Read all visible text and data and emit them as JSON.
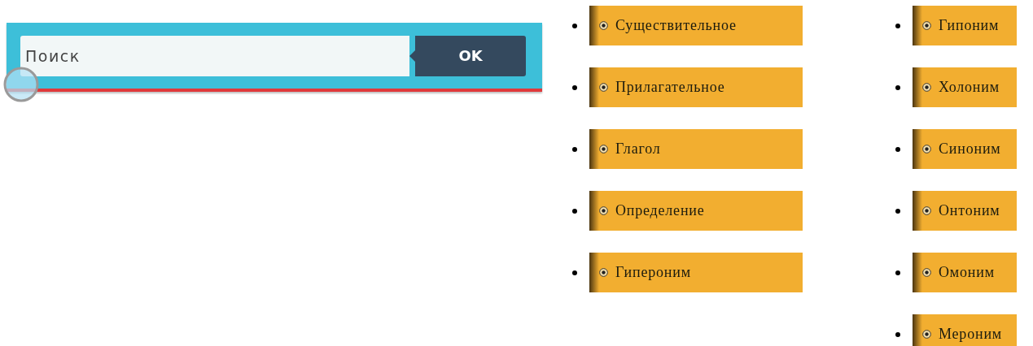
{
  "search": {
    "placeholder": "Поиск",
    "button": "OK"
  },
  "columns": [
    {
      "items": [
        "Существительное",
        "Прилагательное",
        "Глагол",
        "Определение",
        "Гипероним"
      ]
    },
    {
      "items": [
        "Гипоним",
        "Холоним",
        "Синоним",
        "Онтоним",
        "Омоним",
        "Мероним"
      ]
    }
  ]
}
